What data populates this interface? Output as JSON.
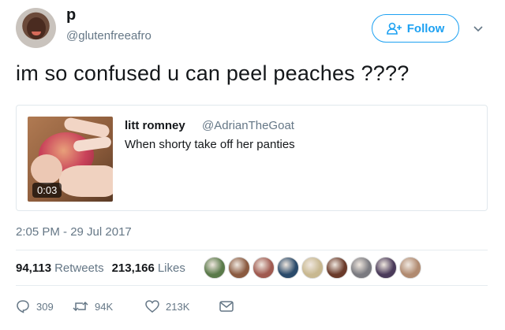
{
  "author": {
    "name": "p",
    "handle": "@glutenfreeafro"
  },
  "follow": {
    "label": "Follow"
  },
  "tweet": {
    "text": "im so confused u can peel peaches ????",
    "timestamp": "2:05 PM - 29 Jul 2017"
  },
  "quoted": {
    "name": "litt romney",
    "handle": "@AdrianTheGoat",
    "text": "When shorty take off her panties",
    "video_duration": "0:03"
  },
  "stats": {
    "retweets_count": "94,113",
    "retweets_label": "Retweets",
    "likes_count": "213,166",
    "likes_label": "Likes"
  },
  "liker_avatar_colors": [
    "#5a7a4a",
    "#8a5a40",
    "#a05a50",
    "#2a4a6a",
    "#c8b890",
    "#6a3a2a",
    "#7a7a80",
    "#4a3a5a",
    "#b08a70"
  ],
  "actions": {
    "reply_count": "309",
    "retweet_count": "94K",
    "like_count": "213K"
  },
  "colors": {
    "accent": "#1da1f2",
    "muted": "#657786",
    "text": "#14171a"
  },
  "icons": [
    "person-plus-icon",
    "chevron-down-icon",
    "reply-icon",
    "retweet-icon",
    "heart-icon",
    "message-icon"
  ]
}
